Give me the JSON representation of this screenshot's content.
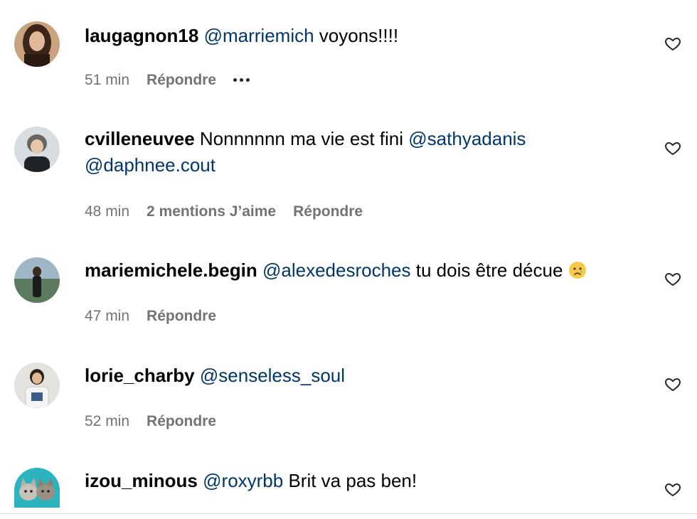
{
  "comments": [
    {
      "username": "laugagnon18",
      "mention1": "@marriemich",
      "text1": " voyons!!!!",
      "mention2": "",
      "time": "51 min",
      "likes": "",
      "reply": "Répondre"
    },
    {
      "username": "cvilleneuvee",
      "text0": " Nonnnnnn ma vie est fini ",
      "mention1": "@sathyadanis",
      "mention2": "@daphnee.cout",
      "time": "48 min",
      "likes": "2 mentions J’aime",
      "reply": "Répondre"
    },
    {
      "username": "mariemichele.begin",
      "mention1": "@alexedesroches",
      "text1": " tu dois être décue ",
      "emoji": "crying-face-emoji",
      "time": "47 min",
      "likes": "",
      "reply": "Répondre"
    },
    {
      "username": "lorie_charby",
      "mention1": "@senseless_soul",
      "time": "52 min",
      "likes": "",
      "reply": "Répondre"
    },
    {
      "username": "izou_minous",
      "mention1": "@roxyrbb",
      "text1": " Brit va pas ben!"
    }
  ],
  "icons": {
    "heart": "heart-outline-icon",
    "more": "more-options-icon"
  },
  "colors": {
    "mention": "#00376b",
    "meta": "#737373"
  }
}
